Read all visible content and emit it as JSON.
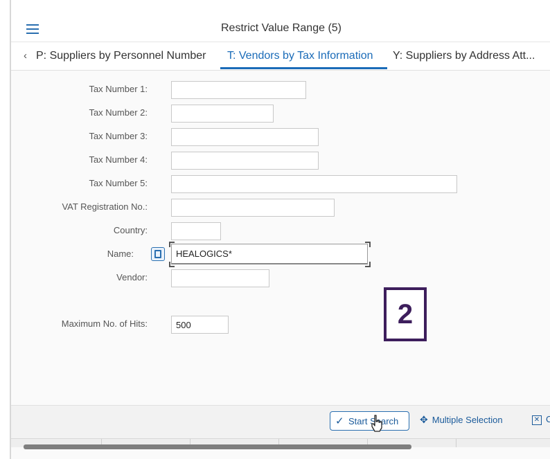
{
  "dialog": {
    "title": "Restrict Value Range (5)"
  },
  "tabs": {
    "scroll_left": "‹",
    "items": [
      {
        "label": "P: Suppliers by Personnel Number"
      },
      {
        "label": "T: Vendors by Tax Information"
      },
      {
        "label": "Y: Suppliers by Address Att..."
      }
    ],
    "active_index": 1
  },
  "form": {
    "fields": [
      {
        "label": "Tax Number 1:",
        "value": ""
      },
      {
        "label": "Tax Number 2:",
        "value": ""
      },
      {
        "label": "Tax Number 3:",
        "value": ""
      },
      {
        "label": "Tax Number 4:",
        "value": ""
      },
      {
        "label": "Tax Number 5:",
        "value": ""
      },
      {
        "label": "VAT Registration No.:",
        "value": ""
      },
      {
        "label": "Country:",
        "value": ""
      },
      {
        "label": "Name:",
        "value": "HEALOGICS*"
      },
      {
        "label": "Vendor:",
        "value": ""
      }
    ],
    "max_hits": {
      "label": "Maximum No. of Hits:",
      "value": "500"
    }
  },
  "annotation": {
    "step": "2"
  },
  "footer": {
    "start_search": "Start Search",
    "multiple_selection": "Multiple Selection",
    "cancel_partial": "C"
  },
  "icons": {
    "menu": "hamburger-menu-icon",
    "value_help": "value-help-icon",
    "check": "checkmark-icon",
    "multiple_selection": "multiple-selection-icon",
    "cancel": "cancel-icon",
    "cursor": "hand-cursor-icon"
  },
  "colors": {
    "accent": "#1a6bb8",
    "annotation": "#3d1e5c"
  }
}
